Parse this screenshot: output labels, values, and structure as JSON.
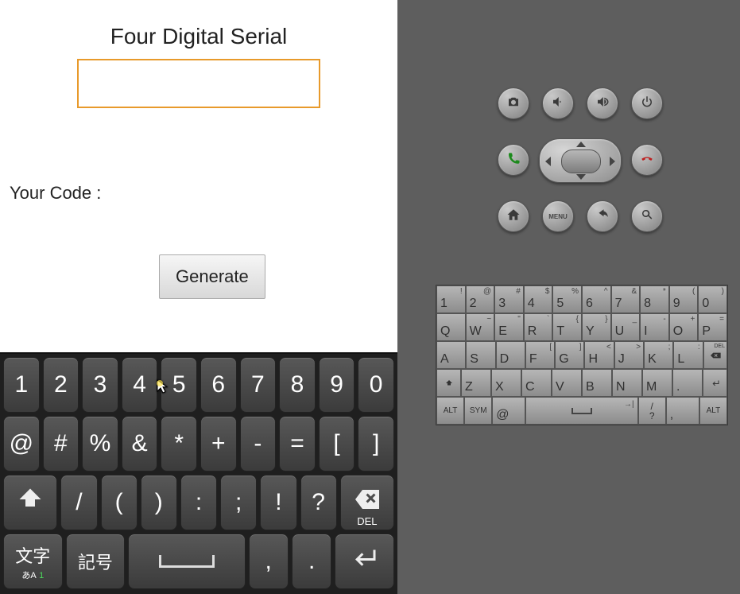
{
  "app": {
    "title": "Four Digital Serial",
    "serial_value": "",
    "code_label": "Your Code :",
    "generate_label": "Generate"
  },
  "soft_kbd": {
    "row1": [
      "1",
      "2",
      "3",
      "4",
      "5",
      "6",
      "7",
      "8",
      "9",
      "0"
    ],
    "row2": [
      "@",
      "#",
      "%",
      "&",
      "*",
      "+",
      "-",
      "=",
      "[",
      "]"
    ],
    "row3": {
      "slash": "/",
      "lparen": "(",
      "rparen": ")",
      "colon": ":",
      "semi": ";",
      "bang": "!",
      "qmark": "?",
      "del": "DEL"
    },
    "row4": {
      "mode_top": "文字",
      "mode_bottom_left": "あA",
      "mode_bottom_right": "1",
      "sym": "記号",
      "comma": ",",
      "period": "."
    }
  },
  "emu_buttons": {
    "menu": "MENU"
  },
  "qwerty": {
    "row1": [
      {
        "k": "1",
        "s": "!"
      },
      {
        "k": "2",
        "s": "@"
      },
      {
        "k": "3",
        "s": "#"
      },
      {
        "k": "4",
        "s": "$"
      },
      {
        "k": "5",
        "s": "%"
      },
      {
        "k": "6",
        "s": "^"
      },
      {
        "k": "7",
        "s": "&"
      },
      {
        "k": "8",
        "s": "*"
      },
      {
        "k": "9",
        "s": "("
      },
      {
        "k": "0",
        "s": ")"
      }
    ],
    "row2": [
      {
        "k": "Q",
        "s": ""
      },
      {
        "k": "W",
        "s": "~"
      },
      {
        "k": "E",
        "s": "\""
      },
      {
        "k": "R",
        "s": "`"
      },
      {
        "k": "T",
        "s": "{"
      },
      {
        "k": "Y",
        "s": "}"
      },
      {
        "k": "U",
        "s": "_"
      },
      {
        "k": "I",
        "s": "-"
      },
      {
        "k": "O",
        "s": "+"
      },
      {
        "k": "P",
        "s": "="
      }
    ],
    "row3": [
      {
        "k": "A",
        "s": ""
      },
      {
        "k": "S",
        "s": ""
      },
      {
        "k": "D",
        "s": ""
      },
      {
        "k": "F",
        "s": "["
      },
      {
        "k": "G",
        "s": "]"
      },
      {
        "k": "H",
        "s": "<"
      },
      {
        "k": "J",
        "s": ">"
      },
      {
        "k": "K",
        "s": ";"
      },
      {
        "k": "L",
        "s": ":"
      }
    ],
    "row3_del": "DEL",
    "row4": [
      {
        "k": "Z",
        "s": ""
      },
      {
        "k": "X",
        "s": ""
      },
      {
        "k": "C",
        "s": ""
      },
      {
        "k": "V",
        "s": ""
      },
      {
        "k": "B",
        "s": ""
      },
      {
        "k": "N",
        "s": ""
      },
      {
        "k": "M",
        "s": ""
      },
      {
        "k": ".",
        "s": ""
      }
    ],
    "row5": {
      "alt": "ALT",
      "sym": "SYM",
      "at": "@",
      "slash": "/",
      "qmark": "?",
      "comma": ",",
      "alt2": "ALT"
    }
  }
}
